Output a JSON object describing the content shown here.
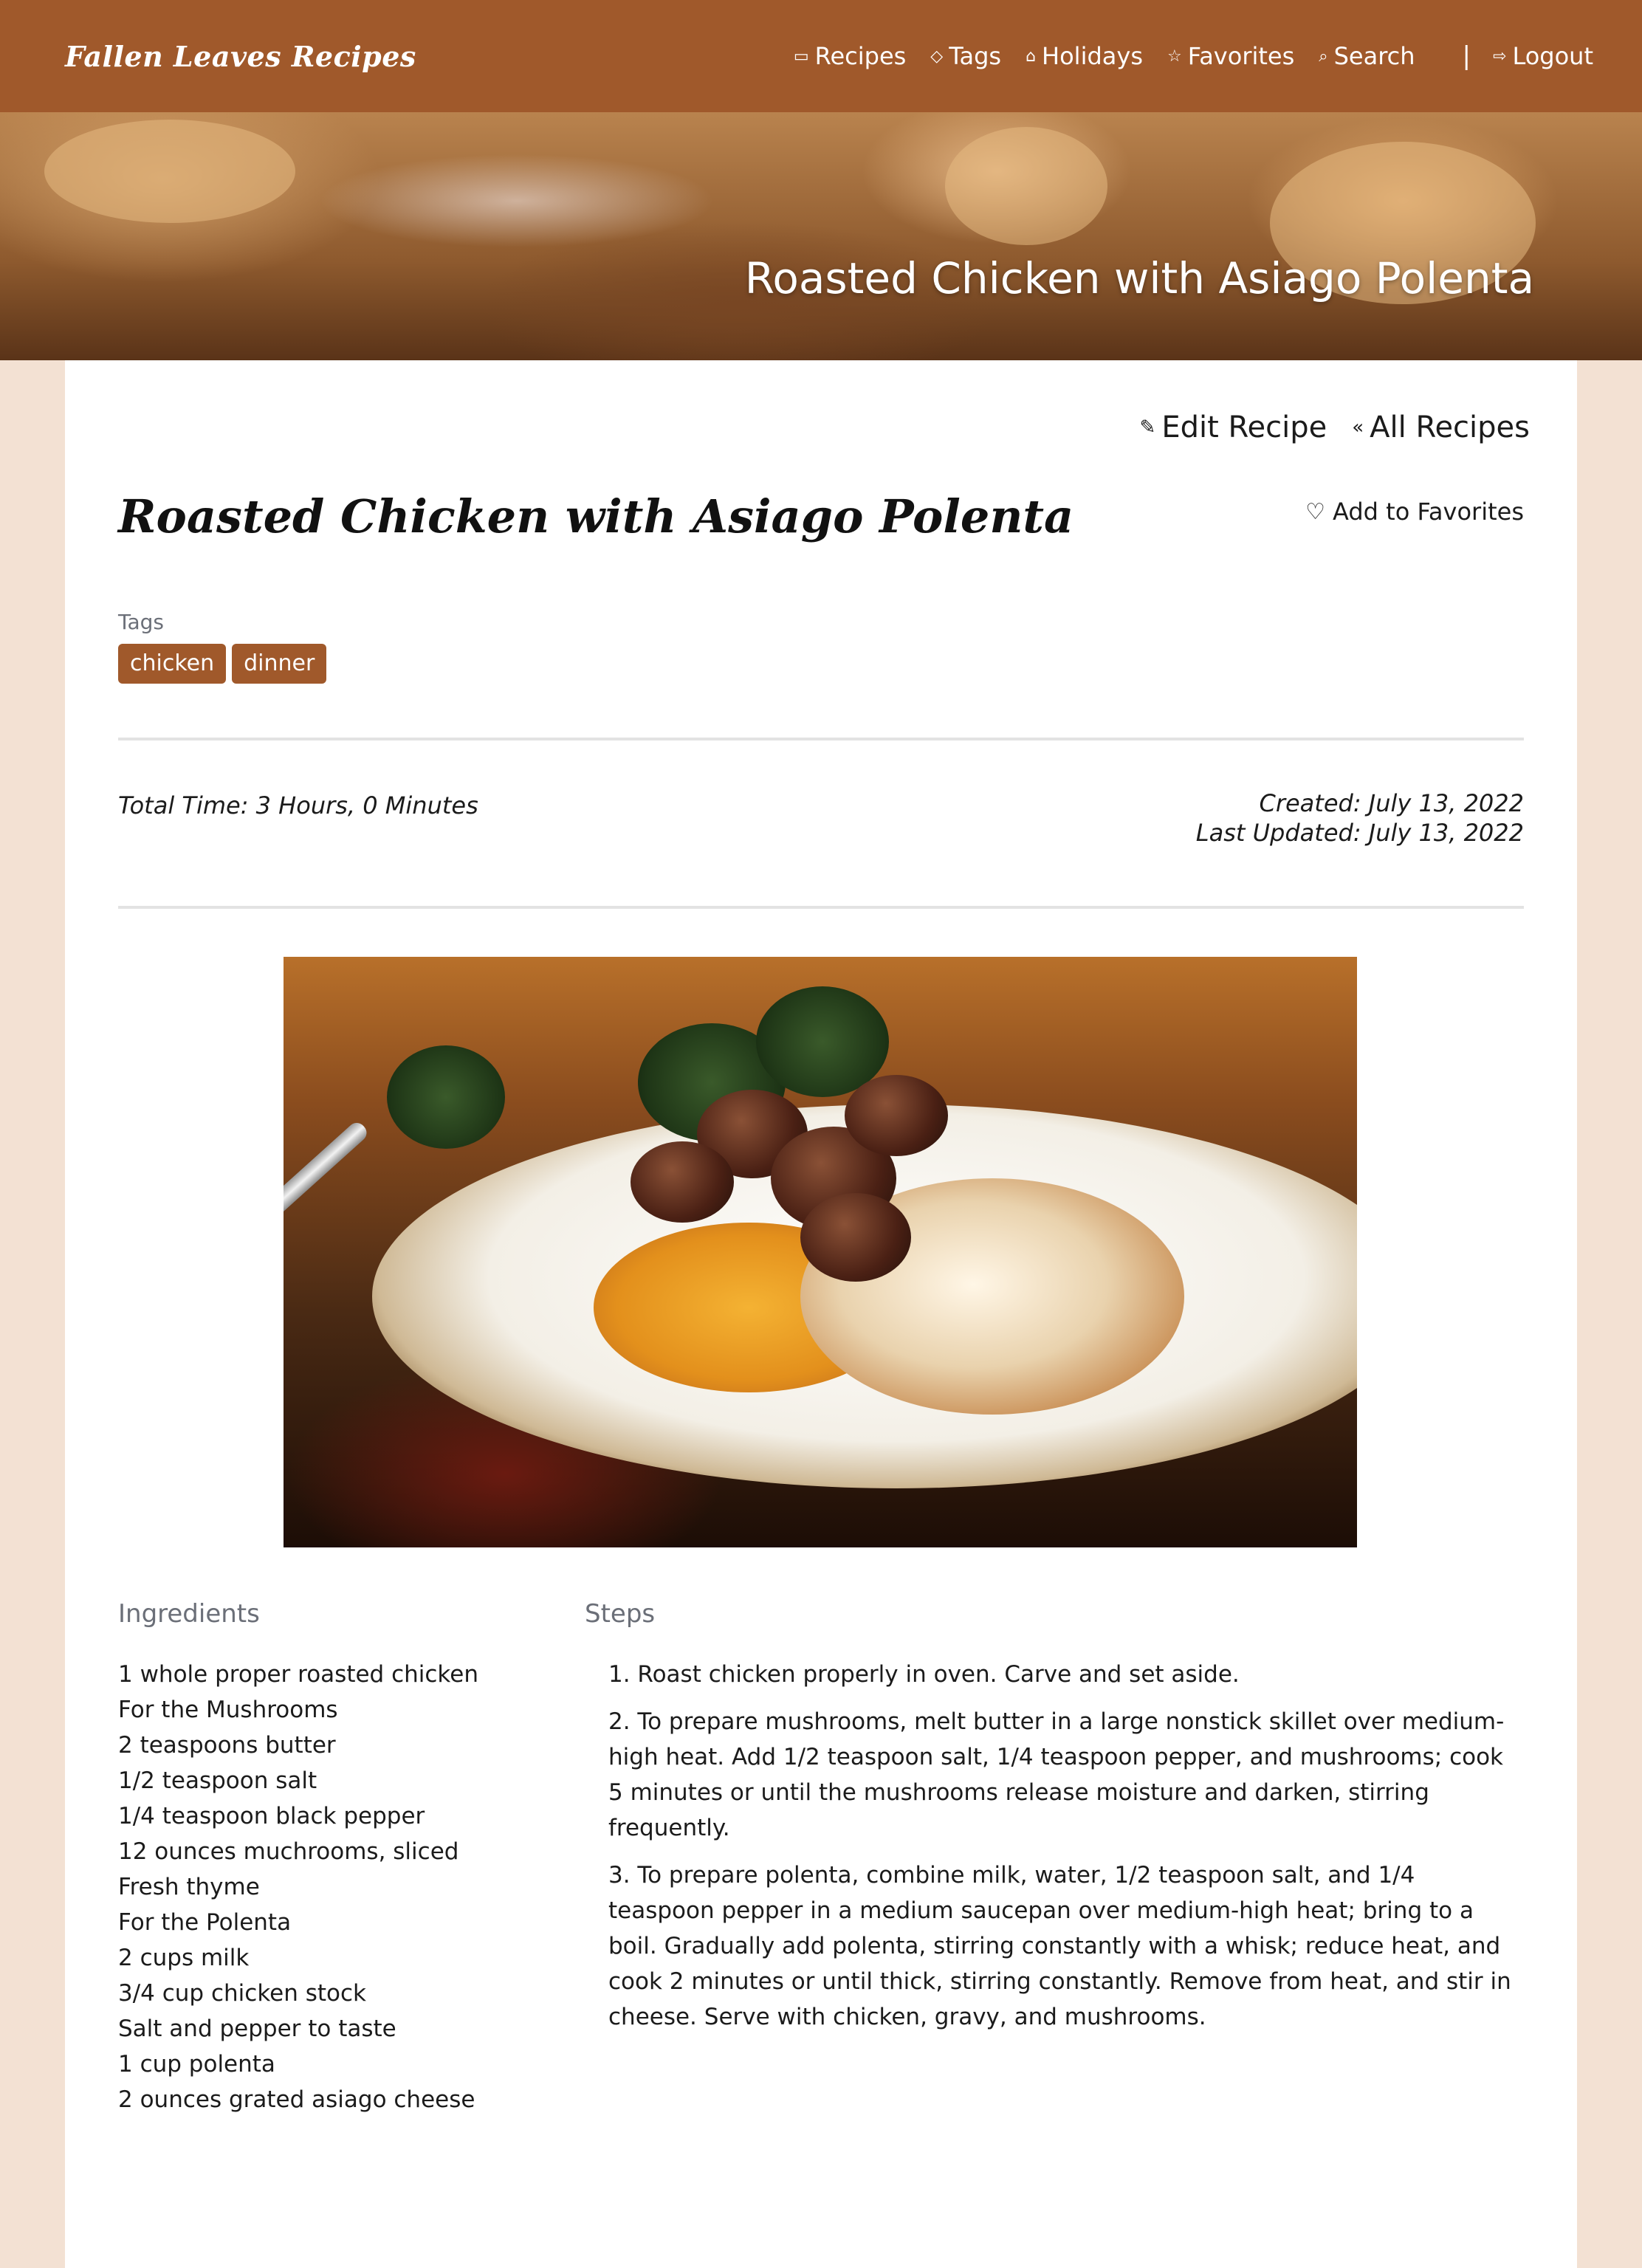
{
  "nav": {
    "brand": "Fallen Leaves Recipes",
    "links": [
      {
        "icon": "recipe-card-icon",
        "glyph": "▭",
        "label": "Recipes"
      },
      {
        "icon": "tag-icon",
        "glyph": "◇",
        "label": "Tags"
      },
      {
        "icon": "cake-icon",
        "glyph": "⌂",
        "label": "Holidays"
      },
      {
        "icon": "star-icon",
        "glyph": "☆",
        "label": "Favorites"
      },
      {
        "icon": "search-icon",
        "glyph": "⌕",
        "label": "Search"
      }
    ],
    "separator": "|",
    "logout": {
      "icon": "logout-icon",
      "glyph": "⇨",
      "label": "Logout"
    }
  },
  "hero": {
    "title": "Roasted Chicken with Asiago Polenta"
  },
  "actions": {
    "edit": {
      "icon": "edit-icon",
      "glyph": "✎",
      "label": "Edit Recipe"
    },
    "all": {
      "icon": "double-chevron-left-icon",
      "glyph": "«",
      "label": "All Recipes"
    }
  },
  "recipe": {
    "title": "Roasted Chicken with Asiago Polenta",
    "favorite": {
      "icon": "heart-icon",
      "glyph": "♡",
      "label": "Add to Favorites"
    },
    "tags_label": "Tags",
    "tags": [
      "chicken",
      "dinner"
    ],
    "total_time": "Total Time: 3 Hours, 0 Minutes",
    "created": "Created: July 13, 2022",
    "updated": "Last Updated: July 13, 2022",
    "ingredients_title": "Ingredients",
    "ingredients": [
      "1 whole proper roasted chicken",
      "For the Mushrooms",
      "2 teaspoons butter",
      "1/2 teaspoon salt",
      "1/4 teaspoon black pepper",
      "12 ounces muchrooms, sliced",
      "Fresh thyme",
      "For the Polenta",
      "2 cups milk",
      "3/4 cup chicken stock",
      "Salt and pepper to taste",
      "1 cup polenta",
      "2 ounces grated asiago cheese"
    ],
    "steps_title": "Steps",
    "steps": [
      "1. Roast chicken properly in oven. Carve and set aside.",
      "2. To prepare mushrooms, melt butter in a large nonstick skillet over medium-high heat. Add 1/2 teaspoon salt, 1/4 teaspoon pepper, and mushrooms; cook 5 minutes or until the mushrooms release moisture and darken, stirring frequently.",
      "3. To prepare polenta, combine milk, water, 1/2 teaspoon salt, and 1/4 teaspoon pepper in a medium saucepan over medium-high heat; bring to a boil. Gradually add polenta, stirring constantly with a whisk; reduce heat, and cook 2 minutes or until thick, stirring constantly. Remove from heat, and stir in cheese. Serve with chicken, gravy, and mushrooms."
    ]
  },
  "colors": {
    "brand": "#a0592b",
    "page_bg": "#f3e1d3",
    "muted": "#6b6f78"
  }
}
